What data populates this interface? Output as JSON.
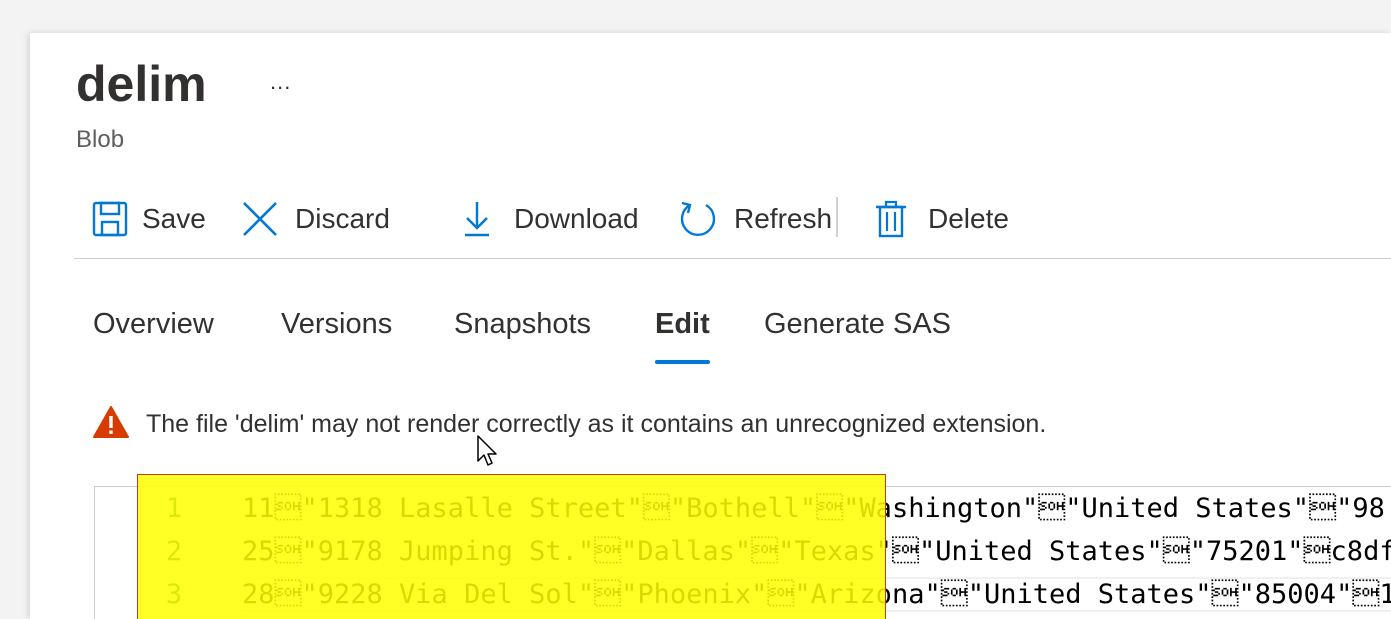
{
  "header": {
    "title": "delim",
    "more_label": "...",
    "subtitle": "Blob"
  },
  "toolbar": {
    "save_label": "Save",
    "discard_label": "Discard",
    "download_label": "Download",
    "refresh_label": "Refresh",
    "delete_label": "Delete",
    "icons": [
      "save-icon",
      "discard-icon",
      "download-icon",
      "refresh-icon",
      "delete-icon"
    ],
    "accent_color": "#0078d4"
  },
  "tabs": [
    {
      "label": "Overview",
      "active": false
    },
    {
      "label": "Versions",
      "active": false
    },
    {
      "label": "Snapshots",
      "active": false
    },
    {
      "label": "Edit",
      "active": true
    },
    {
      "label": "Generate SAS",
      "active": false
    }
  ],
  "warning": {
    "icon": "warning-icon",
    "icon_color": "#d83b01",
    "text": "The file 'delim' may not render correctly as it contains an unrecognized extension."
  },
  "editor": {
    "highlight_color": "#ffff00",
    "lines": [
      {
        "number": "1",
        "text": "11\u0001\"1318 Lasalle Street\"\u0001\"Bothell\"\u0001\"Washington\"\u0001\"United States\"\u0001\"98"
      },
      {
        "number": "2",
        "text": "25\u0001\"9178 Jumping St.\"\u0001\"Dallas\"\u0001\"Texas\"\u0001\"United States\"\u0001\"75201\"\u0001c8df"
      },
      {
        "number": "3",
        "text": "28\u0001\"9228 Via Del Sol\"\u0001\"Phoenix\"\u0001\"Arizona\"\u0001\"United States\"\u0001\"85004\"\u00011"
      }
    ]
  }
}
